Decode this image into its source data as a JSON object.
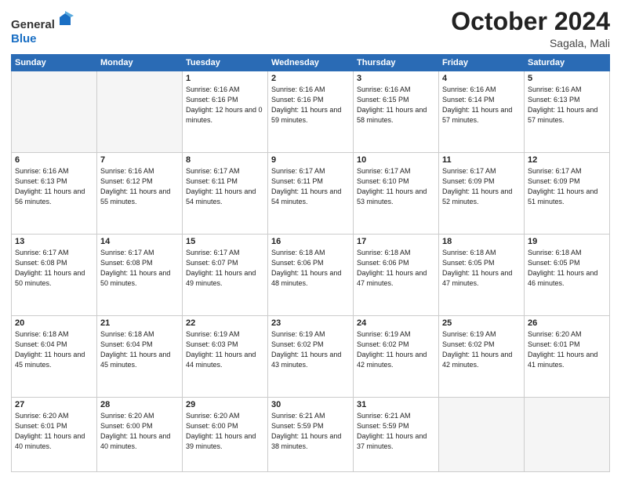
{
  "header": {
    "logo_general": "General",
    "logo_blue": "Blue",
    "month_title": "October 2024",
    "location": "Sagala, Mali"
  },
  "weekdays": [
    "Sunday",
    "Monday",
    "Tuesday",
    "Wednesday",
    "Thursday",
    "Friday",
    "Saturday"
  ],
  "weeks": [
    [
      {
        "day": "",
        "empty": true
      },
      {
        "day": "",
        "empty": true
      },
      {
        "day": "1",
        "sunrise": "Sunrise: 6:16 AM",
        "sunset": "Sunset: 6:16 PM",
        "daylight": "Daylight: 12 hours and 0 minutes."
      },
      {
        "day": "2",
        "sunrise": "Sunrise: 6:16 AM",
        "sunset": "Sunset: 6:16 PM",
        "daylight": "Daylight: 11 hours and 59 minutes."
      },
      {
        "day": "3",
        "sunrise": "Sunrise: 6:16 AM",
        "sunset": "Sunset: 6:15 PM",
        "daylight": "Daylight: 11 hours and 58 minutes."
      },
      {
        "day": "4",
        "sunrise": "Sunrise: 6:16 AM",
        "sunset": "Sunset: 6:14 PM",
        "daylight": "Daylight: 11 hours and 57 minutes."
      },
      {
        "day": "5",
        "sunrise": "Sunrise: 6:16 AM",
        "sunset": "Sunset: 6:13 PM",
        "daylight": "Daylight: 11 hours and 57 minutes."
      }
    ],
    [
      {
        "day": "6",
        "sunrise": "Sunrise: 6:16 AM",
        "sunset": "Sunset: 6:13 PM",
        "daylight": "Daylight: 11 hours and 56 minutes."
      },
      {
        "day": "7",
        "sunrise": "Sunrise: 6:16 AM",
        "sunset": "Sunset: 6:12 PM",
        "daylight": "Daylight: 11 hours and 55 minutes."
      },
      {
        "day": "8",
        "sunrise": "Sunrise: 6:17 AM",
        "sunset": "Sunset: 6:11 PM",
        "daylight": "Daylight: 11 hours and 54 minutes."
      },
      {
        "day": "9",
        "sunrise": "Sunrise: 6:17 AM",
        "sunset": "Sunset: 6:11 PM",
        "daylight": "Daylight: 11 hours and 54 minutes."
      },
      {
        "day": "10",
        "sunrise": "Sunrise: 6:17 AM",
        "sunset": "Sunset: 6:10 PM",
        "daylight": "Daylight: 11 hours and 53 minutes."
      },
      {
        "day": "11",
        "sunrise": "Sunrise: 6:17 AM",
        "sunset": "Sunset: 6:09 PM",
        "daylight": "Daylight: 11 hours and 52 minutes."
      },
      {
        "day": "12",
        "sunrise": "Sunrise: 6:17 AM",
        "sunset": "Sunset: 6:09 PM",
        "daylight": "Daylight: 11 hours and 51 minutes."
      }
    ],
    [
      {
        "day": "13",
        "sunrise": "Sunrise: 6:17 AM",
        "sunset": "Sunset: 6:08 PM",
        "daylight": "Daylight: 11 hours and 50 minutes."
      },
      {
        "day": "14",
        "sunrise": "Sunrise: 6:17 AM",
        "sunset": "Sunset: 6:08 PM",
        "daylight": "Daylight: 11 hours and 50 minutes."
      },
      {
        "day": "15",
        "sunrise": "Sunrise: 6:17 AM",
        "sunset": "Sunset: 6:07 PM",
        "daylight": "Daylight: 11 hours and 49 minutes."
      },
      {
        "day": "16",
        "sunrise": "Sunrise: 6:18 AM",
        "sunset": "Sunset: 6:06 PM",
        "daylight": "Daylight: 11 hours and 48 minutes."
      },
      {
        "day": "17",
        "sunrise": "Sunrise: 6:18 AM",
        "sunset": "Sunset: 6:06 PM",
        "daylight": "Daylight: 11 hours and 47 minutes."
      },
      {
        "day": "18",
        "sunrise": "Sunrise: 6:18 AM",
        "sunset": "Sunset: 6:05 PM",
        "daylight": "Daylight: 11 hours and 47 minutes."
      },
      {
        "day": "19",
        "sunrise": "Sunrise: 6:18 AM",
        "sunset": "Sunset: 6:05 PM",
        "daylight": "Daylight: 11 hours and 46 minutes."
      }
    ],
    [
      {
        "day": "20",
        "sunrise": "Sunrise: 6:18 AM",
        "sunset": "Sunset: 6:04 PM",
        "daylight": "Daylight: 11 hours and 45 minutes."
      },
      {
        "day": "21",
        "sunrise": "Sunrise: 6:18 AM",
        "sunset": "Sunset: 6:04 PM",
        "daylight": "Daylight: 11 hours and 45 minutes."
      },
      {
        "day": "22",
        "sunrise": "Sunrise: 6:19 AM",
        "sunset": "Sunset: 6:03 PM",
        "daylight": "Daylight: 11 hours and 44 minutes."
      },
      {
        "day": "23",
        "sunrise": "Sunrise: 6:19 AM",
        "sunset": "Sunset: 6:02 PM",
        "daylight": "Daylight: 11 hours and 43 minutes."
      },
      {
        "day": "24",
        "sunrise": "Sunrise: 6:19 AM",
        "sunset": "Sunset: 6:02 PM",
        "daylight": "Daylight: 11 hours and 42 minutes."
      },
      {
        "day": "25",
        "sunrise": "Sunrise: 6:19 AM",
        "sunset": "Sunset: 6:02 PM",
        "daylight": "Daylight: 11 hours and 42 minutes."
      },
      {
        "day": "26",
        "sunrise": "Sunrise: 6:20 AM",
        "sunset": "Sunset: 6:01 PM",
        "daylight": "Daylight: 11 hours and 41 minutes."
      }
    ],
    [
      {
        "day": "27",
        "sunrise": "Sunrise: 6:20 AM",
        "sunset": "Sunset: 6:01 PM",
        "daylight": "Daylight: 11 hours and 40 minutes."
      },
      {
        "day": "28",
        "sunrise": "Sunrise: 6:20 AM",
        "sunset": "Sunset: 6:00 PM",
        "daylight": "Daylight: 11 hours and 40 minutes."
      },
      {
        "day": "29",
        "sunrise": "Sunrise: 6:20 AM",
        "sunset": "Sunset: 6:00 PM",
        "daylight": "Daylight: 11 hours and 39 minutes."
      },
      {
        "day": "30",
        "sunrise": "Sunrise: 6:21 AM",
        "sunset": "Sunset: 5:59 PM",
        "daylight": "Daylight: 11 hours and 38 minutes."
      },
      {
        "day": "31",
        "sunrise": "Sunrise: 6:21 AM",
        "sunset": "Sunset: 5:59 PM",
        "daylight": "Daylight: 11 hours and 37 minutes."
      },
      {
        "day": "",
        "empty": true
      },
      {
        "day": "",
        "empty": true
      }
    ]
  ]
}
